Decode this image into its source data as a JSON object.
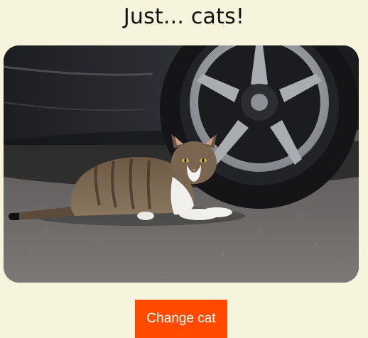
{
  "page": {
    "title": "Just... cats!"
  },
  "photo": {
    "subject": "cat-photo",
    "colors": {
      "asphalt": "#6f6d6b",
      "tire": "#1c1c1e",
      "rim": "#8d8f93",
      "car_body": "#2a2b2e"
    }
  },
  "actions": {
    "change_label": "Change cat",
    "accent": "#ff4a00"
  }
}
